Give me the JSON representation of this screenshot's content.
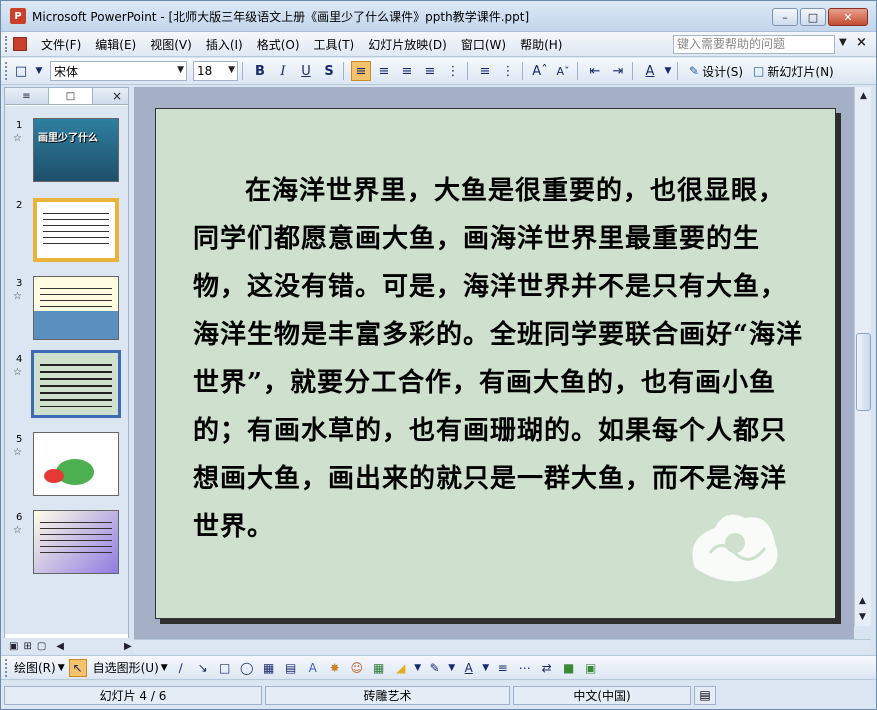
{
  "window": {
    "app_icon_text": "P",
    "title": "Microsoft PowerPoint - [北师大版三年级语文上册《画里少了什么课件》ppth教学课件.ppt]"
  },
  "menu": {
    "items": [
      "文件(F)",
      "编辑(E)",
      "视图(V)",
      "插入(I)",
      "格式(O)",
      "工具(T)",
      "幻灯片放映(D)",
      "窗口(W)",
      "帮助(H)"
    ],
    "help_placeholder": "键入需要帮助的问题"
  },
  "toolbar": {
    "font_name": "宋体",
    "font_size": "18",
    "bold": "B",
    "italic": "I",
    "underline": "U",
    "shadow": "S",
    "design_label": "设计(S)",
    "new_slide_label": "新幻灯片(N)"
  },
  "left_panel": {
    "slides": [
      {
        "num": "1",
        "title": "画里少了什么",
        "style": "underwater"
      },
      {
        "num": "2",
        "style": "colorful-border"
      },
      {
        "num": "3",
        "style": "waves"
      },
      {
        "num": "4",
        "style": "text-green"
      },
      {
        "num": "5",
        "style": "cartoon"
      },
      {
        "num": "6",
        "style": "purple"
      }
    ],
    "selected_index": 4
  },
  "slide": {
    "text": "在海洋世界里，大鱼是很重要的，也很显眼，同学们都愿意画大鱼，画海洋世界里最重要的生物，这没有错。可是，海洋世界并不是只有大鱼，海洋生物是丰富多彩的。全班同学要联合画好“海洋世界”，就要分工合作，有画大鱼的，也有画小鱼的；有画水草的，也有画珊瑚的。如果每个人都只想画大鱼，画出来的就只是一群大鱼，而不是海洋世界。"
  },
  "drawing_toolbar": {
    "draw_label": "绘图(R)",
    "autoshapes_label": "自选图形(U)"
  },
  "status": {
    "slide_info": "幻灯片 4 / 6",
    "design": "砖雕艺术",
    "language": "中文(中国)"
  },
  "colors": {
    "slide_bg": "#cfe0cf",
    "selection": "#3d6bb5",
    "title_bar": "#c3d6ec"
  }
}
